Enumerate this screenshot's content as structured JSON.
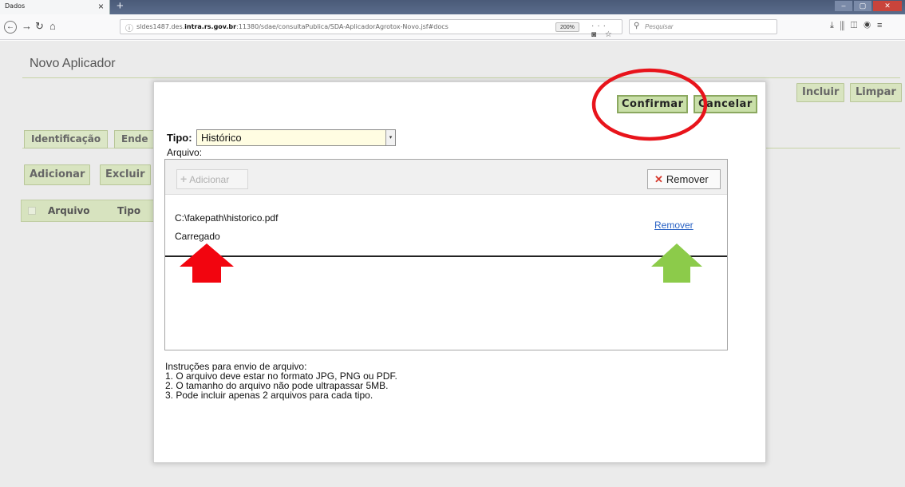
{
  "browser": {
    "tab_title": "Dados",
    "tab_close": "×",
    "new_tab": "+",
    "url_prefix": "sldes1487.des.",
    "url_domain": "intra.rs.gov.br",
    "url_rest": ":11380/sdae/consultaPublica/SDA-AplicadorAgrotox-Novo.jsf#docs",
    "zoom": "200%",
    "search_placeholder": "Pesquisar",
    "icons": [
      "back-icon",
      "forward-icon",
      "reload-icon",
      "home-icon",
      "lock-icon",
      "more-icon",
      "pocket-icon",
      "bookmark-star-icon",
      "search-icon",
      "download-icon",
      "library-icon",
      "sidebar-icon",
      "account-icon",
      "menu-icon"
    ]
  },
  "page": {
    "title": "Novo Aplicador",
    "incluir_label": "Incluir",
    "limpar_label": "Limpar",
    "tabs": [
      {
        "label": "Identificação"
      },
      {
        "label": "Ende"
      }
    ],
    "adicionar_label": "Adicionar",
    "excluir_label": "Excluir",
    "grid_columns": [
      "Arquivo",
      "Tipo"
    ]
  },
  "modal": {
    "confirmar_label": "Confirmar",
    "cancelar_label": "Cancelar",
    "tipo_label": "Tipo:",
    "tipo_value": "Histórico",
    "arquivo_label": "Arquivo:",
    "upload": {
      "add_label": "Adicionar",
      "remove_label": "Remover",
      "file_name": "C:\\fakepath\\historico.pdf",
      "file_status": "Carregado",
      "file_remove_link": "Remover"
    },
    "instructions": [
      "Instruções para envio de arquivo:",
      "1. O arquivo deve estar no formato JPG, PNG ou PDF.",
      "2. O tamanho do arquivo não pode ultrapassar 5MB.",
      "3. Pode incluir apenas 2 arquivos para cada tipo."
    ]
  },
  "annotations": {
    "ellipse_color": "#e8141b",
    "red_arrow_color": "#f2050f",
    "green_arrow_color": "#8ccb4a"
  }
}
